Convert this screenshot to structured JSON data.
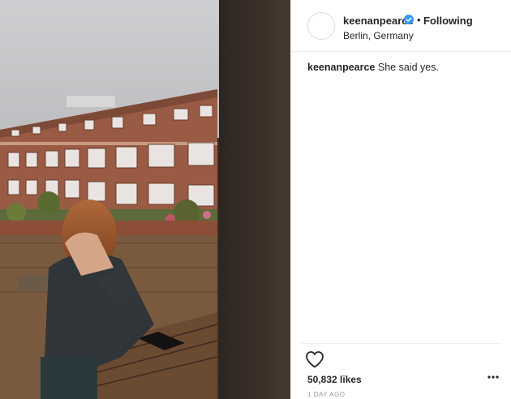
{
  "post": {
    "photo": {
      "icon": "photo-balcony-berlin"
    },
    "header": {
      "username": "keenanpearce",
      "verified_icon": "verified-badge-icon",
      "separator": "•",
      "follow_status": "Following",
      "location": "Berlin, Germany"
    },
    "caption": {
      "username": "keenanpearce",
      "text": "She said yes."
    },
    "actions": {
      "like_icon": "heart-icon",
      "more_icon": "more-options-icon"
    },
    "likes": "50,832 likes",
    "timestamp": "1 DAY AGO",
    "colors": {
      "verified": "#3897f0",
      "text": "#262626",
      "muted": "#999999",
      "divider": "#efefef"
    }
  }
}
